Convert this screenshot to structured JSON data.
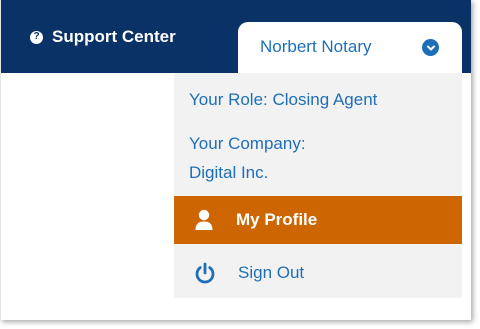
{
  "header": {
    "support_label": "Support Center",
    "support_icon": "question-circle-icon",
    "user_name": "Norbert Notary",
    "user_chevron_icon": "chevron-down-circle-icon"
  },
  "menu": {
    "role": "Your Role: Closing Agent",
    "company_label": "Your Company:",
    "company_name": "Digital Inc.",
    "items": [
      {
        "label": "My Profile",
        "icon": "user-icon",
        "active": true
      },
      {
        "label": "Sign Out",
        "icon": "power-icon",
        "active": false
      }
    ]
  },
  "colors": {
    "header_bg": "#0a3266",
    "link": "#1e6fb7",
    "active_item_bg": "#cd6600",
    "menu_bg": "#f2f2f2"
  }
}
